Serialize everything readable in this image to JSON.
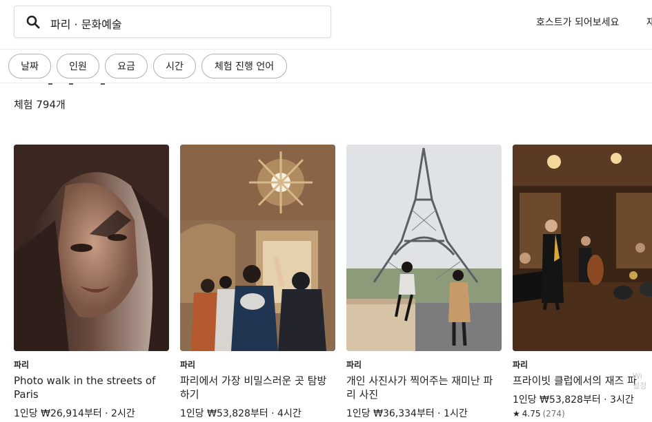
{
  "search": {
    "text": "파리 · 문화예술"
  },
  "header": {
    "host_link": "호스트가 되어보세요",
    "host_link_cut": "재"
  },
  "filters": [
    "날짜",
    "인원",
    "요금",
    "시간",
    "체험 진행 언어"
  ],
  "results": {
    "count_label": "체험 794개"
  },
  "cards": [
    {
      "location": "파리",
      "title": "Photo walk in the streets of Paris",
      "price": "1인당 ₩26,914부터 · 2시간"
    },
    {
      "location": "파리",
      "title": "파리에서 가장 비밀스러운 곳 탐방하기",
      "price": "1인당 ₩53,828부터 · 4시간"
    },
    {
      "location": "파리",
      "title": "개인 사진사가 찍어주는 재미난 파리 사진",
      "price": "1인당 ₩36,334부터 · 1시간"
    },
    {
      "location": "파리",
      "title": "프라이빗 클럽에서의 재즈 파",
      "price": "1인당 ₩53,828부터 · 3시간",
      "rating": "4.75",
      "reviews": "(274)"
    }
  ],
  "icons": {
    "search": "search-icon",
    "star": "star-icon"
  },
  "watermark": {
    "line1": "Wi",
    "line2": "설정"
  }
}
